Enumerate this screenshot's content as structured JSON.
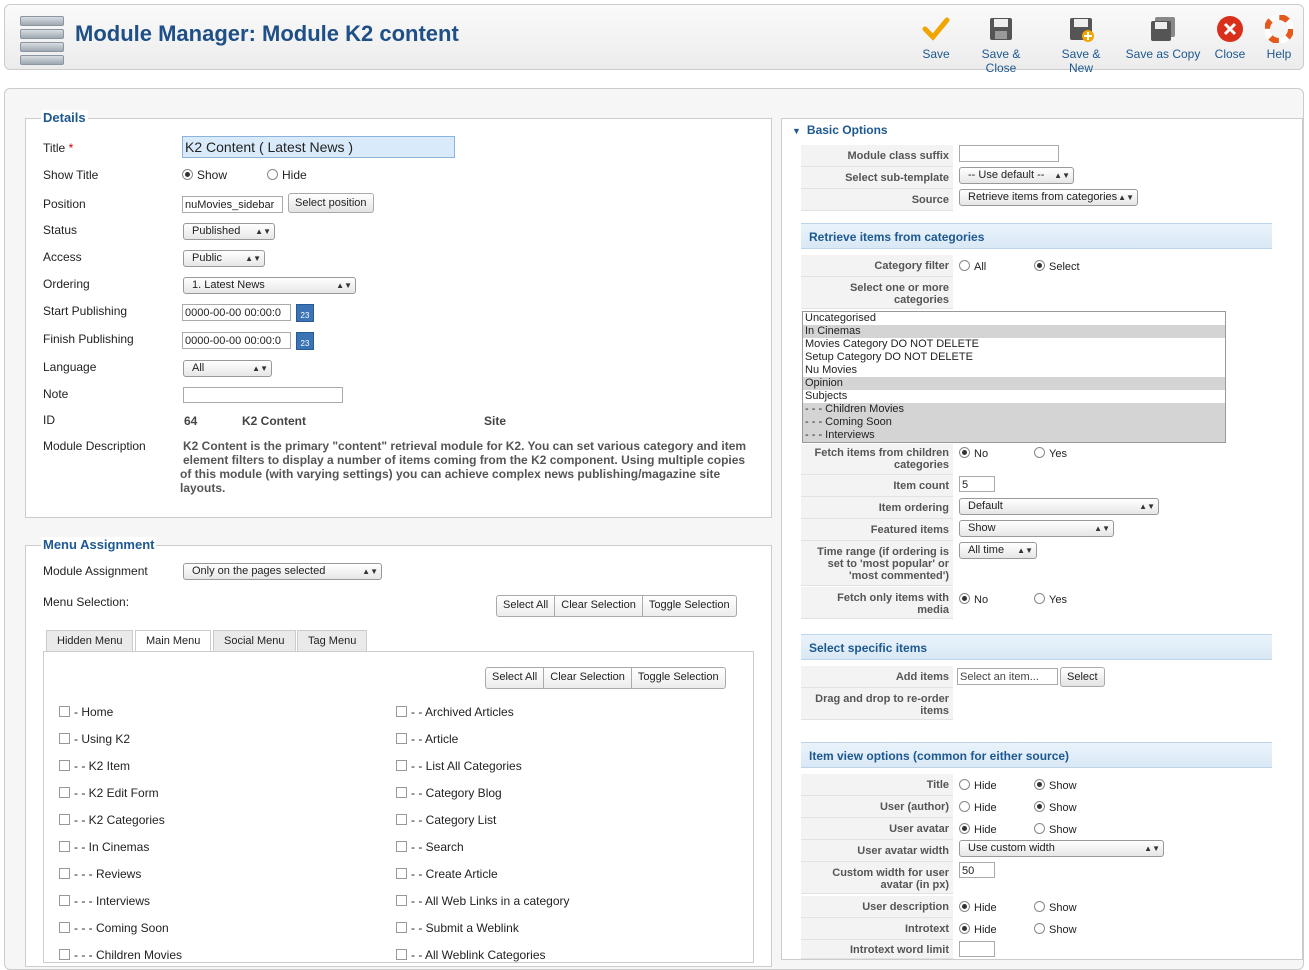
{
  "header": {
    "title": "Module Manager: Module K2 content",
    "buttons": [
      "Save",
      "Save & Close",
      "Save & New",
      "Save as Copy",
      "Close",
      "Help"
    ]
  },
  "details": {
    "legend": "Details",
    "title_label": "Title",
    "required_mark": "*",
    "title_value": "K2 Content ( Latest News )",
    "show_title_label": "Show Title",
    "show_opt": "Show",
    "hide_opt": "Hide",
    "position_label": "Position",
    "position_value": "nuMovies_sidebar",
    "select_position": "Select position",
    "status_label": "Status",
    "status_value": "Published",
    "access_label": "Access",
    "access_value": "Public",
    "ordering_label": "Ordering",
    "ordering_value": "1. Latest News",
    "start_label": "Start Publishing",
    "start_value": "0000-00-00 00:00:0",
    "finish_label": "Finish Publishing",
    "finish_value": "0000-00-00 00:00:0",
    "calendar_day": "23",
    "language_label": "Language",
    "language_value": "All",
    "note_label": "Note",
    "id_label": "ID",
    "id_value": "64",
    "id_name": "K2 Content",
    "id_site": "Site",
    "desc_label": "Module Description",
    "desc_line1": "K2 Content is the primary \"content\" retrieval module for K2. You can set various category and item",
    "desc_line2": "element filters to display a number of items coming from the K2 component. Using multiple copies",
    "desc_line3": "of this module (with varying settings) you can achieve complex news publishing/magazine site",
    "desc_line4": "layouts."
  },
  "menu": {
    "legend": "Menu Assignment",
    "assignment_label": "Module Assignment",
    "assignment_value": "Only on the pages selected",
    "selection_label": "Menu Selection:",
    "btns": [
      "Select All",
      "Clear Selection",
      "Toggle Selection"
    ],
    "tabs": [
      "Hidden Menu",
      "Main Menu",
      "Social Menu",
      "Tag Menu"
    ],
    "col1": [
      "- Home",
      "- Using K2",
      "- - K2 Item",
      "- - K2 Edit Form",
      "- - K2 Categories",
      "- - In Cinemas",
      "- - - Reviews",
      "- - - Interviews",
      "- - - Coming Soon",
      "- - - Children Movies"
    ],
    "col2": [
      "- - Archived Articles",
      "- - Article",
      "- - List All Categories",
      "- - Category Blog",
      "- - Category List",
      "- - Search",
      "- - Create Article",
      "- - All Web Links in a category",
      "- - Submit a Weblink",
      "- - All Weblink Categories"
    ]
  },
  "basic": {
    "heading": "Basic Options",
    "class_suffix": "Module class suffix",
    "subtemplate": "Select sub-template",
    "subtemplate_value": "-- Use default --",
    "source": "Source",
    "source_value": "Retrieve items from categories",
    "sec_retrieve": "Retrieve items from categories",
    "cat_filter": "Category filter",
    "opt_all": "All",
    "opt_select": "Select",
    "select_cats_1": "Select one or more",
    "select_cats_2": "categories",
    "categories": [
      "Uncategorised",
      "In Cinemas",
      "Movies Category DO NOT DELETE",
      "Setup Category DO NOT DELETE",
      "Nu Movies",
      "Opinion",
      "Subjects",
      "- - - Children Movies",
      "- - - Coming Soon",
      "- - - Interviews"
    ],
    "fetch_children_1": "Fetch items from children",
    "fetch_children_2": "categories",
    "opt_no": "No",
    "opt_yes": "Yes",
    "item_count": "Item count",
    "item_count_value": "5",
    "item_ordering": "Item ordering",
    "item_ordering_value": "Default",
    "featured": "Featured items",
    "featured_value": "Show",
    "time_range_1": "Time range (if ordering is",
    "time_range_2": "set to 'most popular' or",
    "time_range_3": "'most commented')",
    "time_range_value": "All time",
    "fetch_media_1": "Fetch only items with",
    "fetch_media_2": "media",
    "sec_specific": "Select specific items",
    "add_items": "Add items",
    "add_items_placeholder": "Select an item...",
    "select_btn": "Select",
    "drag_1": "Drag and drop to re-order",
    "drag_2": "items",
    "sec_view": "Item view options (common for either source)",
    "v_title": "Title",
    "v_user": "User (author)",
    "v_avatar": "User avatar",
    "v_avatar_width": "User avatar width",
    "v_avatar_width_value": "Use custom width",
    "v_custom_1": "Custom width for user",
    "v_custom_2": "avatar (in px)",
    "v_custom_value": "50",
    "v_desc": "User description",
    "v_intro": "Introtext",
    "v_intro_limit": "Introtext word limit",
    "opt_hide": "Hide",
    "opt_show": "Show"
  },
  "colors": {
    "accent": "#1d5890",
    "save": "#f0a500",
    "close": "#d9301c"
  }
}
